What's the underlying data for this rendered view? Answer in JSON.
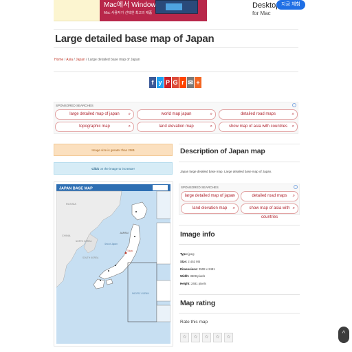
{
  "ad": {
    "left_title": "Mac에서 Windows 앱 실행",
    "left_sub": "Mac 사용자가 선택한 최고의 제품",
    "right_title": "Desktop",
    "right_sub": "for Mac",
    "cta": "지금 체험"
  },
  "page_title": "Large detailed base map of Japan",
  "breadcrumb": {
    "home": "Home",
    "sep": " / ",
    "asia": "Asia",
    "japan": "Japan",
    "current": "Large detailed base map of Japan"
  },
  "share": {
    "icons": [
      "f",
      "y",
      "P",
      "G",
      "r",
      "✉",
      "+"
    ],
    "colors": [
      "#3b5998",
      "#1da1f2",
      "#cb2027",
      "#dd4b39",
      "#ff4500",
      "#7a7a7a",
      "#f26522"
    ]
  },
  "sponsored1": {
    "label": "SPONSORED SEARCHES",
    "items": [
      "large detailed map of japan",
      "world map japan",
      "detailed road maps",
      "topographic map",
      "land elevation map",
      "show map of asia with countries"
    ]
  },
  "notice_size": "Image size is greater than 2MB",
  "notice_click": {
    "click": "Click",
    "rest": " on the image to increase!"
  },
  "map_image": {
    "title": "JAPAN BASE MAP",
    "label_russia": "RUSSIA",
    "label_china": "CHINA",
    "label_nkorea": "NORTH KOREA",
    "label_skorea": "SOUTH KOREA",
    "label_japan": "JAPAN",
    "label_sea_japan": "Sea of Japan",
    "label_pacific": "PACIFIC OCEAN",
    "label_tokyo": "Tokyo"
  },
  "description": {
    "heading": "Description of Japan map",
    "text": "Japan large detailed base map. Large detailed base map of Japan."
  },
  "sponsored2": {
    "label": "SPONSORED SEARCHES",
    "items": [
      "large detailed map of japan",
      "detailed road maps",
      "land elevation map",
      "show map of asia with countries"
    ]
  },
  "image_info": {
    "heading": "Image info",
    "type_label": "Type:",
    "type_value": " jpeg",
    "size_label": "Size:",
    "size_value": " 2.453 Mb",
    "dim_label": "Dimensions:",
    "dim_value": " 3508 x 2481",
    "width_label": "Width:",
    "width_value": " 3508 pixels",
    "height_label": "Height:",
    "height_value": " 2481 pixels"
  },
  "rating": {
    "heading": "Map rating",
    "label": "Rate this map",
    "star": "☆"
  },
  "to_top": "^"
}
